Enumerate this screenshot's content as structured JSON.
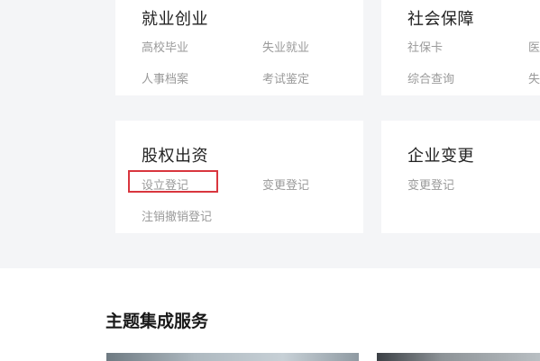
{
  "cards": [
    {
      "title": "就业创业",
      "links": [
        "高校毕业",
        "失业就业",
        "人事档案",
        "考试鉴定"
      ]
    },
    {
      "title": "社会保障",
      "links": [
        "社保卡",
        "医",
        "综合查询",
        "失"
      ]
    },
    {
      "title": "股权出资",
      "links": [
        "设立登记",
        "变更登记",
        "注销撤销登记"
      ]
    },
    {
      "title": "企业变更",
      "links": [
        "变更登记"
      ]
    }
  ],
  "section": {
    "title": "主题集成服务"
  },
  "colors": {
    "page_background": "#f4f5f7",
    "highlight": "#d9363e"
  }
}
